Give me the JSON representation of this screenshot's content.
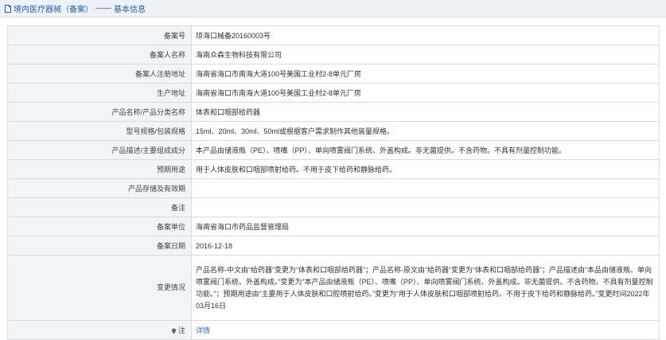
{
  "header": {
    "title": "境内医疗器械（备案）",
    "separator": "——",
    "subtitle": "基本信息",
    "accent_color": "#2a5ca8"
  },
  "rows": [
    {
      "label": "备案号",
      "value": "琼海口械备20160003号"
    },
    {
      "label": "备案人名称",
      "value": "海南众森生物科技有限公司"
    },
    {
      "label": "备案人注册地址",
      "value": "海南省海口市南海大道100号美国工业村2-8单元厂房"
    },
    {
      "label": "生产地址",
      "value": "海南省海口市南海大道100号美国工业村2-8单元厂房"
    },
    {
      "label": "产品名称/产品分类名称",
      "value": "体表和口咽部给药器"
    },
    {
      "label": "型号规格/包装规格",
      "value": "15ml、20ml、30ml、50ml或根据客户需求制作其他装量规格。"
    },
    {
      "label": "产品描述/主要组成成分",
      "value": "本产品由储液瓶（PE）、喷嘴（PP）、单向喷雾阀门系统、外盖构成。非无菌提供。不含药物。不具有剂量控制功能。"
    },
    {
      "label": "预期用途",
      "value": "用于人体皮肤和口咽部喷射给药。不用于皮下给药和静脉给药。"
    },
    {
      "label": "产品存储及有效期",
      "value": ""
    },
    {
      "label": "备注",
      "value": ""
    },
    {
      "label": "备案单位",
      "value": "海南省海口市药品监督管理局"
    },
    {
      "label": "备案日期",
      "value": "2016-12-18"
    },
    {
      "label": "变更情况",
      "value": "产品名称-中文由“给药器”变更为“体表和口咽部给药器”；产品名称-原文由“给药器”变更为“体表和口咽部给药器”；产品描述由“本品由储液瓶、单向喷雾阀门系统、外盖构成。”变更为“本产品由储液瓶（PE）、喷嘴（PP）、单向喷雾阀门系统、外盖构成。非无菌提供。不含药物。不具有剂量控制功能。”；预期用途由“主要用于人体皮肤和口腔喷射给药。”变更为“用于人体皮肤和口咽部喷射给药。不用于皮下给药和静脉给药。”变更时间2022年03月16日"
    },
    {
      "label": "注",
      "value": "详情"
    }
  ],
  "icons": {
    "title_icon": "document-icon",
    "note_icon": "bulb-icon"
  }
}
